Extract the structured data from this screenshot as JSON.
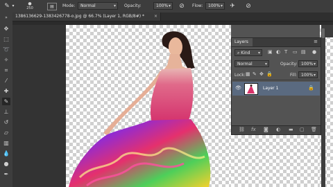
{
  "options_bar": {
    "brush_size": "250",
    "mode_label": "Mode:",
    "mode_value": "Normal",
    "opacity_label": "Opacity:",
    "opacity_value": "100%",
    "flow_label": "Flow:",
    "flow_value": "100%"
  },
  "document": {
    "tab_title": "1386136629-1383426778-o.jpg @ 66.7% (Layer 1, RGB/8#) *",
    "close_glyph": "×"
  },
  "layers_panel": {
    "title": "Layers",
    "menu_glyph": "≡",
    "kind_value": "Kind",
    "blend_value": "Normal",
    "opacity_label": "Opacity:",
    "opacity_value": "100%",
    "lock_label": "Lock:",
    "fill_label": "Fill:",
    "fill_value": "100%",
    "layers": [
      {
        "name": "Layer 1",
        "visible": true,
        "locked": true
      }
    ],
    "footer_icons": [
      "link-icon",
      "fx-icon",
      "mask-icon",
      "adjustment-icon",
      "group-folder-icon",
      "new-layer-icon",
      "trash-icon"
    ]
  },
  "image": {
    "subject": "woman in pink dress with multicolor floral skirt on transparent background"
  },
  "colors": {
    "ui_dark": "#3d3d3d",
    "panel": "#535353",
    "selected_layer": "#5a6a80",
    "dress_pink": "#d8336a"
  }
}
